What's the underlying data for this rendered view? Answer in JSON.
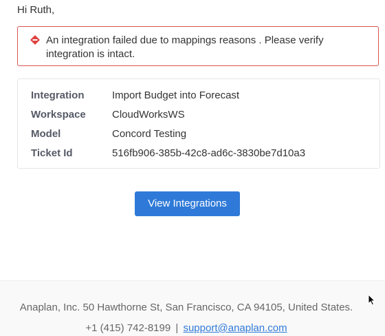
{
  "greeting": "Hi Ruth,",
  "alert": {
    "icon": "warning-diamond-icon",
    "message": "An integration failed due to mappings reasons . Please verify integration is intact.",
    "border_color": "#d9534f",
    "icon_color": "#e0413d"
  },
  "details": [
    {
      "label": "Integration",
      "value": "Import Budget into Forecast"
    },
    {
      "label": "Workspace",
      "value": "CloudWorksWS"
    },
    {
      "label": "Model",
      "value": "Concord Testing"
    },
    {
      "label": "Ticket Id",
      "value": "516fb906-385b-42c8-ad6c-3830be7d10a3"
    }
  ],
  "action": {
    "label": "View Integrations",
    "color": "#2f7ad8"
  },
  "footer": {
    "address": "Anaplan, Inc. 50 Hawthorne St, San Francisco, CA 94105, United States.",
    "phone": "+1 (415) 742-8199",
    "separator": "|",
    "email": "support@anaplan.com"
  }
}
